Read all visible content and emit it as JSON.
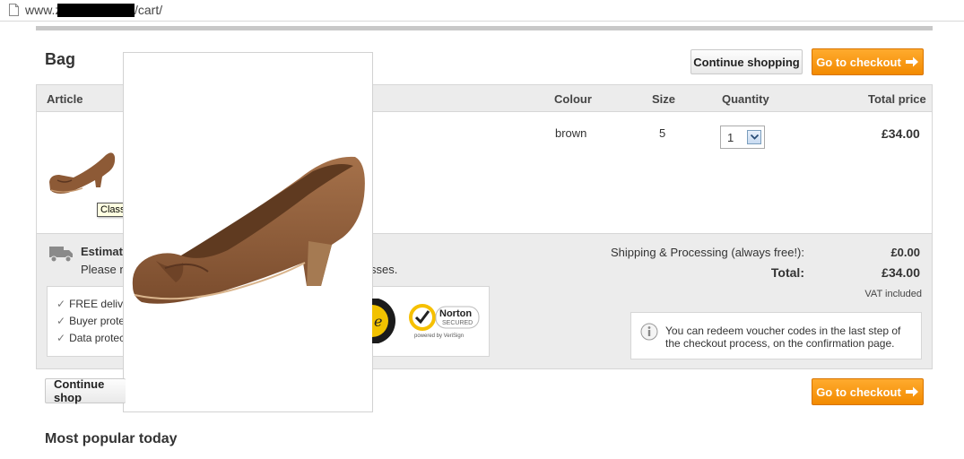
{
  "browser": {
    "url_prefix": "www.z",
    "url_suffix": "/cart/"
  },
  "bag": {
    "title": "Bag",
    "continue_label": "Continue shopping",
    "checkout_label": "Go to checkout",
    "columns": {
      "article": "Article",
      "colour": "Colour",
      "size": "Size",
      "quantity": "Quantity",
      "total_price": "Total price"
    },
    "item": {
      "colour": "brown",
      "size": "5",
      "quantity": "1",
      "total_price": "£34.00",
      "tooltip": "Classic heels - brown"
    }
  },
  "shipping": {
    "estimate_title": "Estimate",
    "estimate_text_start": "Please n",
    "estimate_text_end": "sses.",
    "label": "Shipping & Processing (always free!):",
    "value": "£0.00",
    "total_label": "Total:",
    "total_value": "£34.00",
    "vat": "VAT included"
  },
  "trust": {
    "items": [
      "FREE delive",
      "Buyer prote",
      "Data protec"
    ],
    "norton_label": "Norton",
    "norton_sub": "SECURED",
    "norton_powered": "powered by VeriSign"
  },
  "voucher": {
    "line1": "You can redeem voucher codes in the last step of",
    "line2": "the checkout process, on the confirmation page."
  },
  "bottom": {
    "continue_label": "Continue shop",
    "checkout_label": "Go to checkout"
  },
  "popular": {
    "title": "Most popular today"
  },
  "colors": {
    "accent": "#f28a00",
    "panel": "#ececec"
  }
}
